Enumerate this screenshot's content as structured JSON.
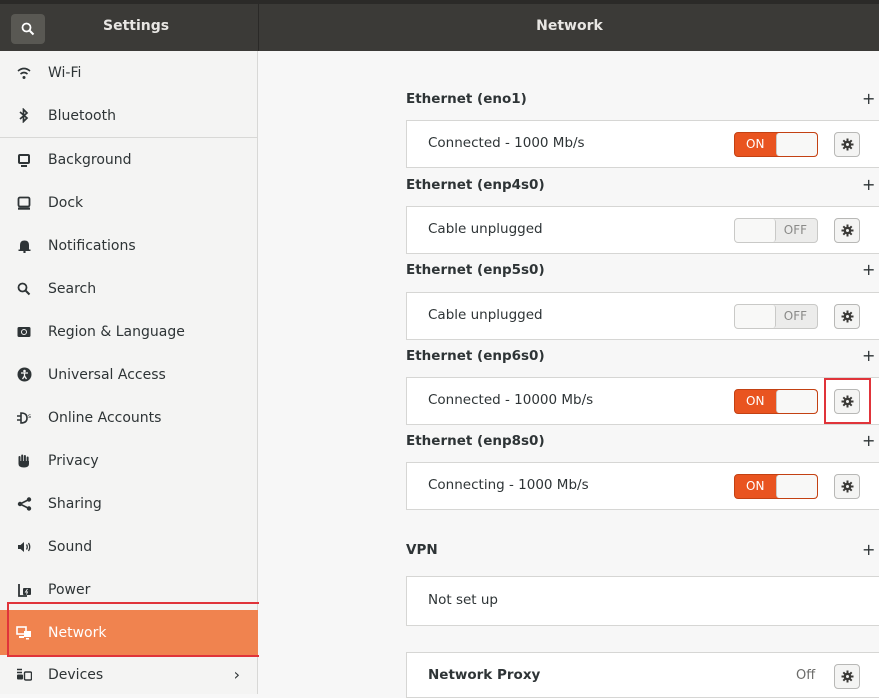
{
  "header": {
    "settings_title": "Settings",
    "panel_title": "Network"
  },
  "sidebar": {
    "items": [
      {
        "label": "Wi-Fi",
        "icon": "wifi-icon"
      },
      {
        "label": "Bluetooth",
        "icon": "bluetooth-icon"
      },
      {
        "label": "Background",
        "icon": "background-icon"
      },
      {
        "label": "Dock",
        "icon": "dock-icon"
      },
      {
        "label": "Notifications",
        "icon": "bell-icon"
      },
      {
        "label": "Search",
        "icon": "search-icon"
      },
      {
        "label": "Region & Language",
        "icon": "region-icon"
      },
      {
        "label": "Universal Access",
        "icon": "accessibility-icon"
      },
      {
        "label": "Online Accounts",
        "icon": "online-accounts-icon"
      },
      {
        "label": "Privacy",
        "icon": "hand-icon"
      },
      {
        "label": "Sharing",
        "icon": "share-icon"
      },
      {
        "label": "Sound",
        "icon": "speaker-icon"
      },
      {
        "label": "Power",
        "icon": "power-icon"
      },
      {
        "label": "Network",
        "icon": "network-icon",
        "active": true
      },
      {
        "label": "Devices",
        "icon": "devices-icon",
        "chevron": "›"
      }
    ]
  },
  "network": {
    "ethernet": [
      {
        "title": "Ethernet (eno1)",
        "add": "+",
        "status": "Connected - 1000 Mb/s",
        "toggle": "ON"
      },
      {
        "title": "Ethernet (enp4s0)",
        "add": "+",
        "status": "Cable unplugged",
        "toggle": "OFF"
      },
      {
        "title": "Ethernet (enp5s0)",
        "add": "+",
        "status": "Cable unplugged",
        "toggle": "OFF"
      },
      {
        "title": "Ethernet (enp6s0)",
        "add": "+",
        "status": "Connected - 10000 Mb/s",
        "toggle": "ON"
      },
      {
        "title": "Ethernet (enp8s0)",
        "add": "+",
        "status": "Connecting - 1000 Mb/s",
        "toggle": "ON"
      }
    ],
    "vpn": {
      "title": "VPN",
      "add": "+",
      "status": "Not set up"
    },
    "proxy": {
      "label": "Network Proxy",
      "value": "Off"
    }
  },
  "colors": {
    "accent": "#e95420",
    "active_item": "#f0834f",
    "highlight": "#e0343a",
    "header": "#3b3a37"
  }
}
